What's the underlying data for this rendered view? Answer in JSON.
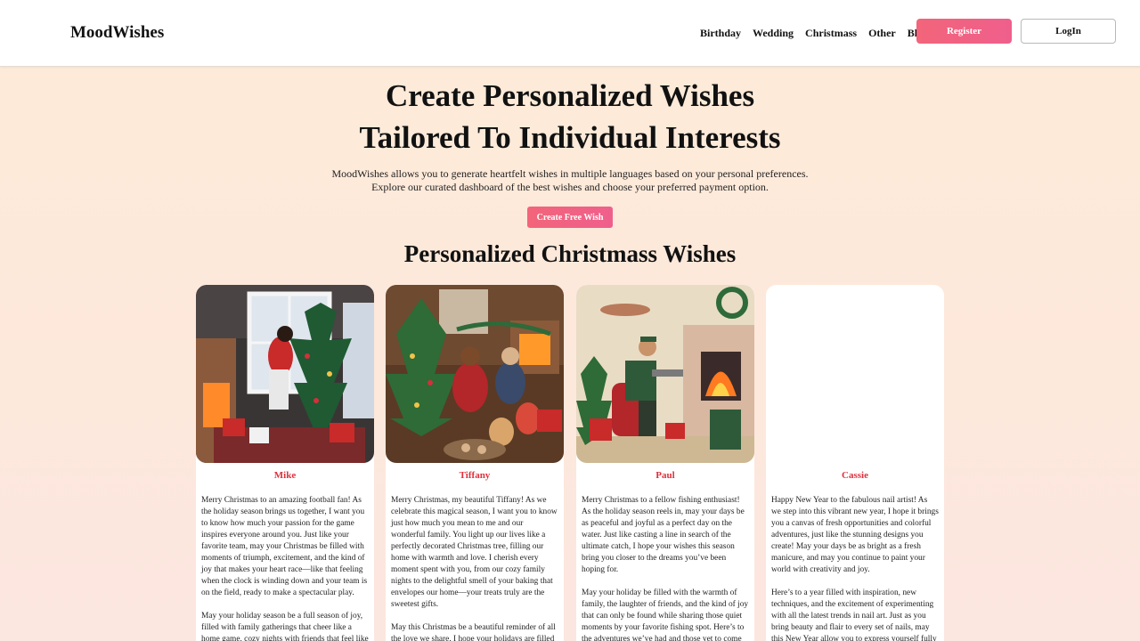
{
  "header": {
    "logo": "MoodWishes",
    "nav": [
      "Birthday",
      "Wedding",
      "Christmass",
      "Other",
      "Blog"
    ],
    "register_label": "Register",
    "login_label": "LogIn"
  },
  "hero": {
    "title_line1": "Create Personalized Wishes",
    "title_line2": "Tailored To Individual Interests",
    "desc_line1": "MoodWishes allows you to generate heartfelt wishes in multiple languages based on your personal preferences.",
    "desc_line2": "Explore our curated dashboard of the best wishes and choose your preferred payment option.",
    "cta_label": "Create Free Wish"
  },
  "section": {
    "title": "Personalized Christmass Wishes"
  },
  "cards": [
    {
      "name": "Mike",
      "image": "christmas-football-illustration",
      "paragraphs": [
        "Merry Christmas to an amazing football fan! As the holiday season brings us together, I want you to know how much your passion for the game inspires everyone around you. Just like your favorite team, may your Christmas be filled with moments of triumph, excitement, and the kind of joy that makes your heart race—like that feeling when the clock is winding down and your team is on the field, ready to make a spectacular play.",
        "May your holiday season be a full season of joy, filled with family gatherings that cheer like a home game, cozy nights with friends that feel like"
      ]
    },
    {
      "name": "Tiffany",
      "image": "christmas-family-illustration",
      "paragraphs": [
        "Merry Christmas, my beautiful Tiffany! As we celebrate this magical season, I want you to know just how much you mean to me and our wonderful family. You light up our lives like a perfectly decorated Christmas tree, filling our home with warmth and love. I cherish every moment spent with you, from our cozy family nights to the delightful smell of your baking that envelopes our home—your treats truly are the sweetest gifts.",
        "May this Christmas be a beautiful reminder of all the love we share. I hope your holidays are filled with laughter, family traditions, and delicious"
      ]
    },
    {
      "name": "Paul",
      "image": "christmas-fishing-illustration",
      "paragraphs": [
        "Merry Christmas to a fellow fishing enthusiast! As the holiday season reels in, may your days be as peaceful and joyful as a perfect day on the water. Just like casting a line in search of the ultimate catch, I hope your wishes this season bring you closer to the dreams you’ve been hoping for.",
        "May your holiday be filled with the warmth of family, the laughter of friends, and the kind of joy that can only be found while sharing those quiet moments by your favorite fishing spot. Here’s to the adventures we’ve had and those yet to come—each one a new opportunity to make memories"
      ]
    },
    {
      "name": "Cassie",
      "image": "",
      "paragraphs": [
        "Happy New Year to the fabulous nail artist! As we step into this vibrant new year, I hope it brings you a canvas of fresh opportunities and colorful adventures, just like the stunning designs you create! May your days be as bright as a fresh manicure, and may you continue to paint your world with creativity and joy.",
        "Here’s to a year filled with inspiration, new techniques, and the excitement of experimenting with all the latest trends in nail art. Just as you bring beauty and flair to every set of nails, may this New Year allow you to express yourself fully"
      ]
    }
  ],
  "colors": {
    "accent": "#f2657a",
    "name_red": "#e0303c"
  }
}
